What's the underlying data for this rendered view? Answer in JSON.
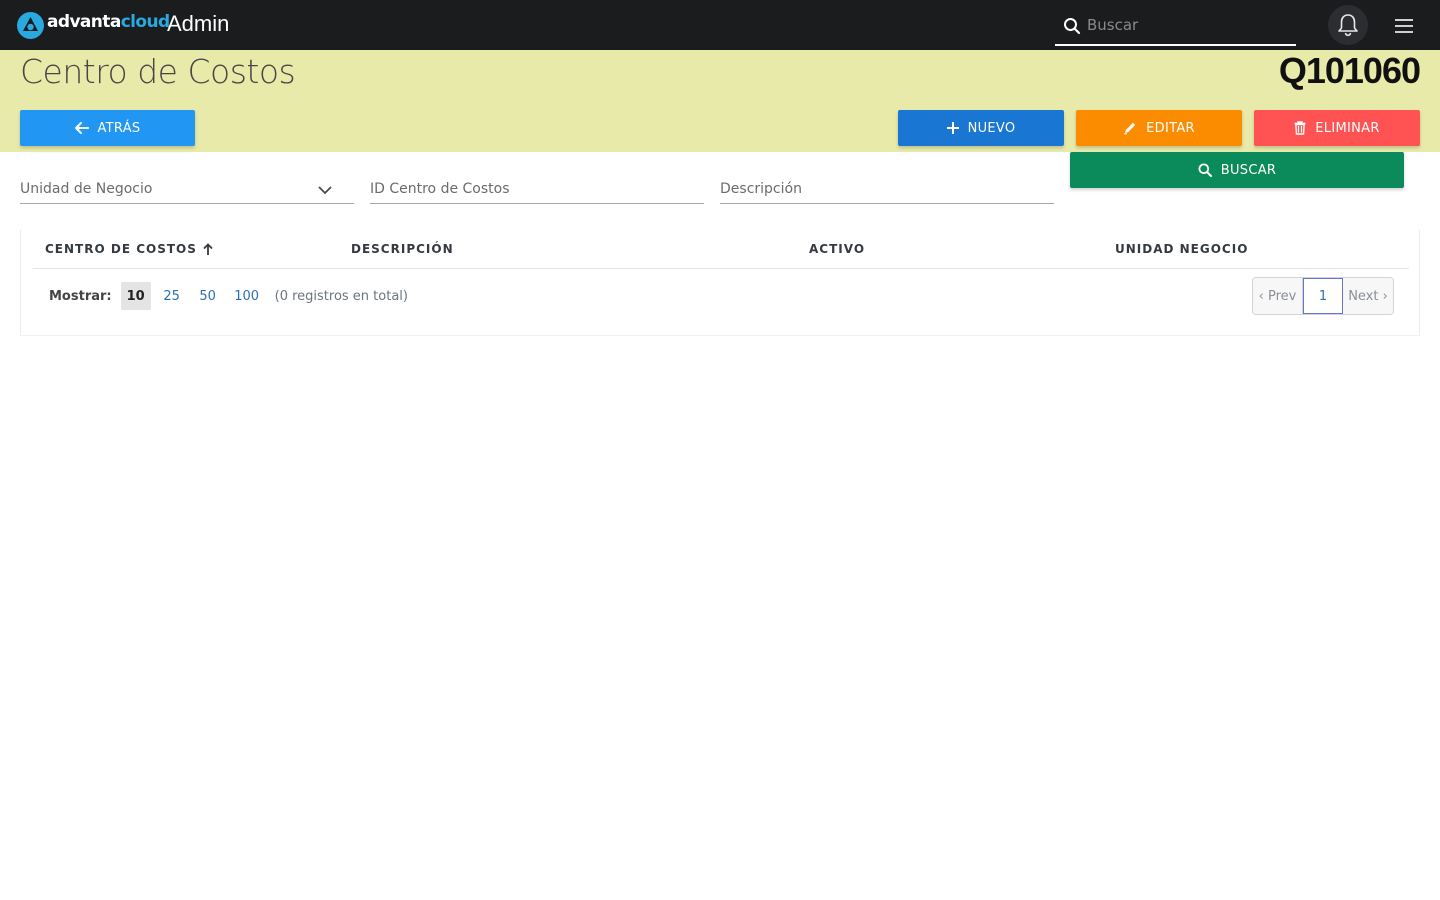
{
  "brand": {
    "name_part1": "advanta",
    "name_part2": "cloud",
    "accent": "#2aa8e0"
  },
  "app_title": "Admin",
  "search": {
    "placeholder": "Buscar"
  },
  "header": {
    "title": "Centro de Costos",
    "code": "Q101060",
    "band_color": "#e8eaa9"
  },
  "actions": {
    "back": "ATRÁS",
    "new": "NUEVO",
    "edit": "EDITAR",
    "delete": "ELIMINAR",
    "search": "BUSCAR"
  },
  "filters": {
    "business_unit": "Unidad de Negocio",
    "cost_center_id": "ID Centro de Costos",
    "description": "Descripción"
  },
  "table": {
    "columns": [
      "CENTRO DE COSTOS",
      "DESCRIPCIÓN",
      "ACTIVO",
      "UNIDAD NEGOCIO"
    ],
    "sort_column": "CENTRO DE COSTOS",
    "sort_direction": "asc",
    "rows": []
  },
  "pagination": {
    "show_label": "Mostrar:",
    "page_sizes": [
      "10",
      "25",
      "50",
      "100"
    ],
    "selected_size": "10",
    "total_text": "(0 registros en total)",
    "prev": "‹ Prev",
    "current_page": "1",
    "next": "Next ›"
  },
  "icons": {
    "logo": "advantacloud-logo-icon",
    "search": "search-icon",
    "bell": "bell-icon",
    "menu": "hamburger-menu-icon",
    "back": "arrow-left-icon",
    "new": "plus-icon",
    "edit": "pencil-icon",
    "delete": "trash-icon",
    "sort": "arrow-up-icon",
    "dropdown": "chevron-down-icon"
  },
  "colors": {
    "back": "#2196f3",
    "new": "#1976d2",
    "edit": "#fb8c00",
    "delete": "#ff5252",
    "search": "#0b8a5c"
  }
}
